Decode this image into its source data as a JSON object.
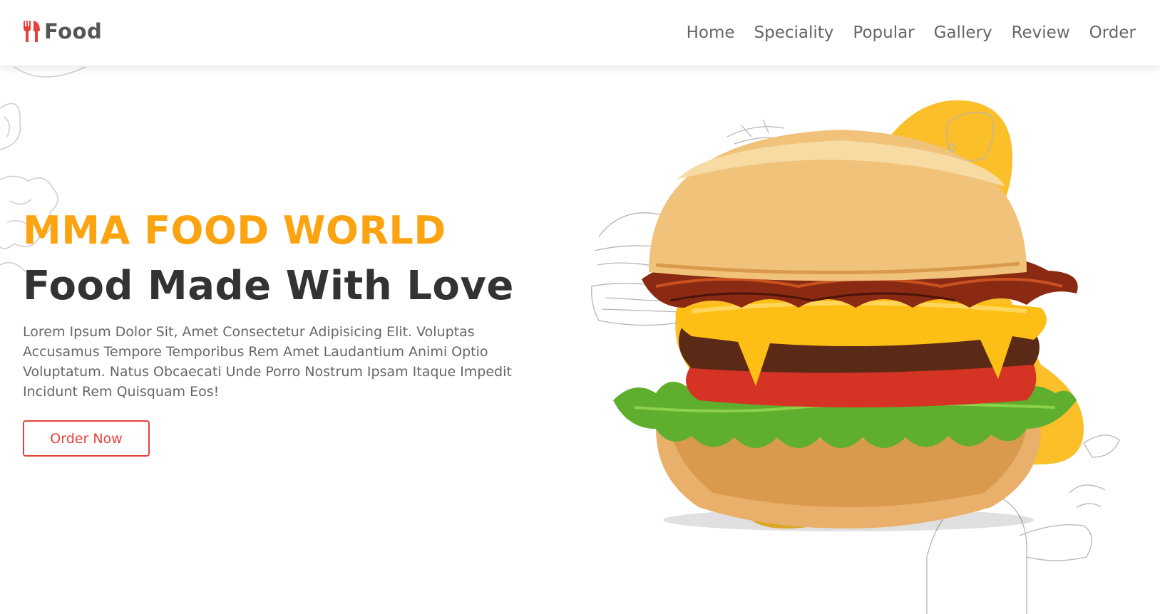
{
  "header": {
    "logo_text": "Food",
    "nav": [
      "Home",
      "Speciality",
      "Popular",
      "Gallery",
      "Review",
      "Order"
    ]
  },
  "hero": {
    "eyebrow": "MMA FOOD WORLD",
    "headline": "Food Made With Love",
    "description": "Lorem Ipsum Dolor Sit, Amet Consectetur Adipisicing Elit. Voluptas Accusamus Tempore Temporibus Rem Amet Laudantium Animi Optio Voluptatum. Natus Obcaecati Unde Porro Nostrum Ipsam Itaque Impedit Incidunt Rem Quisquam Eos!",
    "cta_label": "Order Now"
  },
  "colors": {
    "brand_red": "#e7403a",
    "accent_yellow": "#fca311",
    "blob_yellow": "#fbbf2a",
    "heading_dark": "#333333",
    "text_gray": "#666666"
  },
  "icons": {
    "logo": "utensils-icon"
  },
  "image": {
    "subject": "burger-image"
  }
}
